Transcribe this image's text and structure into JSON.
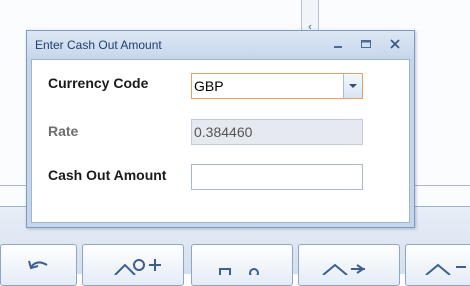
{
  "dialog": {
    "title": "Enter Cash Out Amount",
    "fields": {
      "currency_code": {
        "label": "Currency Code",
        "value": "GBP"
      },
      "rate": {
        "label": "Rate",
        "value": "0.384460"
      },
      "cash_out_amount": {
        "label": "Cash Out Amount",
        "value": ""
      }
    }
  },
  "icons": {
    "minimize": "minimize-icon",
    "restore": "restore-icon",
    "close": "close-icon",
    "dropdown": "chevron-down-icon"
  }
}
